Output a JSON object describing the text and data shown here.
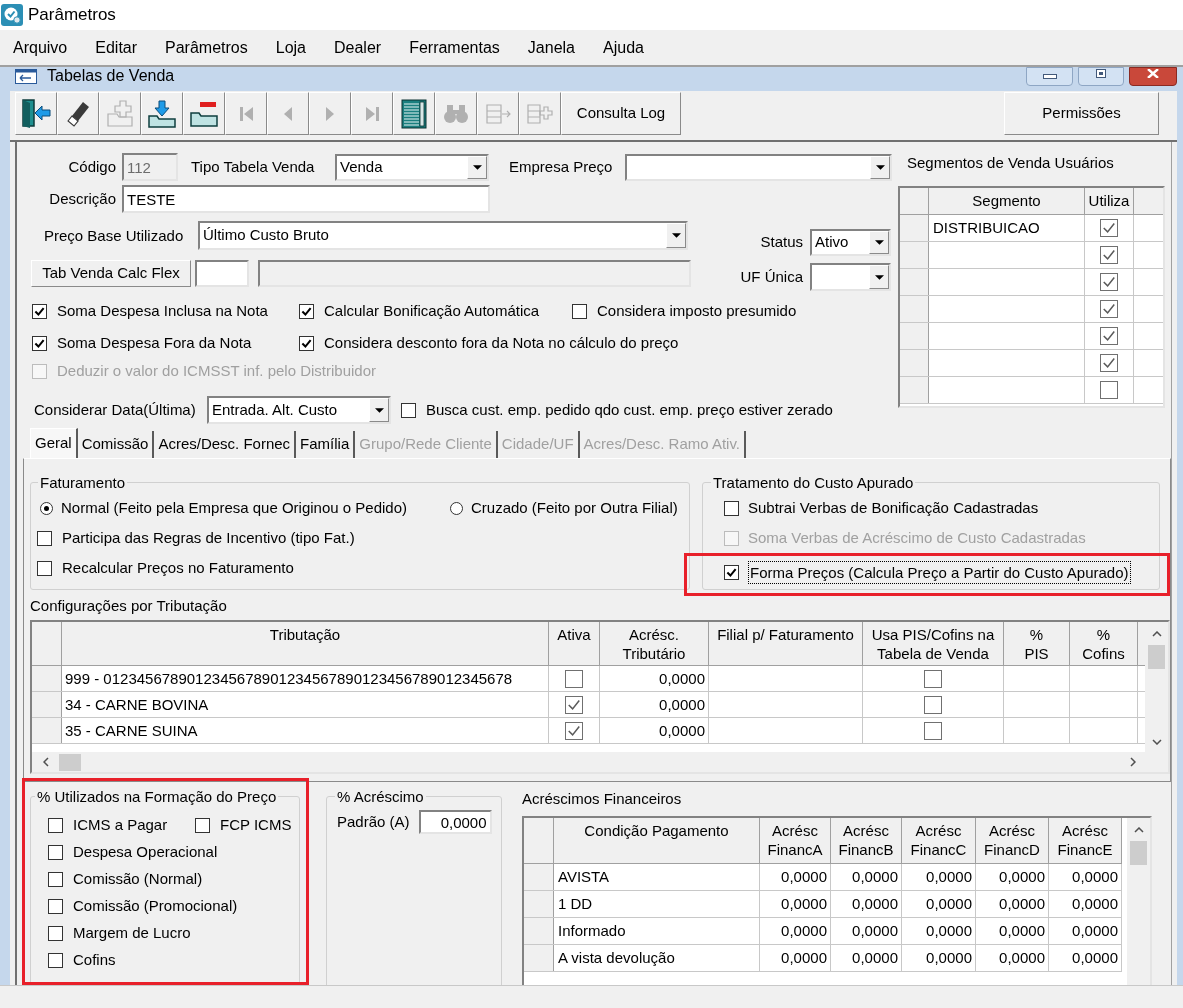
{
  "app": {
    "title": "Parâmetros"
  },
  "menu": [
    "Arquivo",
    "Editar",
    "Parâmetros",
    "Loja",
    "Dealer",
    "Ferramentas",
    "Janela",
    "Ajuda"
  ],
  "window": {
    "title": "Tabelas de Venda"
  },
  "toolbar": {
    "buttons": [
      {
        "kind": "exit",
        "disabled": false
      },
      {
        "kind": "erase",
        "disabled": false
      },
      {
        "kind": "add",
        "disabled": true
      },
      {
        "kind": "save",
        "disabled": false
      },
      {
        "kind": "remove",
        "disabled": false
      },
      {
        "kind": "first",
        "disabled": true
      },
      {
        "kind": "prev",
        "disabled": true
      },
      {
        "kind": "next",
        "disabled": true
      },
      {
        "kind": "last",
        "disabled": true
      },
      {
        "kind": "grid",
        "disabled": false
      },
      {
        "kind": "find",
        "disabled": true
      },
      {
        "kind": "export",
        "disabled": true
      },
      {
        "kind": "import",
        "disabled": true
      }
    ],
    "log_button": "Consulta Log",
    "permissions_button": "Permissões"
  },
  "form": {
    "codigo": {
      "label": "Código",
      "value": "112",
      "disabled": true
    },
    "tipo": {
      "label": "Tipo Tabela Venda",
      "value": "Venda"
    },
    "empresa": {
      "label": "Empresa Preço"
    },
    "descricao": {
      "label": "Descrição",
      "value": "TESTE"
    },
    "preco_base": {
      "label": "Preço Base Utilizado",
      "value": "Último Custo Bruto"
    },
    "calc_flex": {
      "button": "Tab Venda Calc Flex",
      "fields": [
        {
          "disabled": false
        },
        {
          "disabled": true
        }
      ]
    },
    "status": {
      "label": "Status",
      "value": "Ativo"
    },
    "uf": {
      "label": "UF Única"
    },
    "option_rows": [
      [
        {
          "label": "Soma Despesa Inclusa na Nota",
          "checked": true,
          "disabled": false
        },
        {
          "label": "Calcular Bonificação Automática",
          "checked": true,
          "disabled": false
        },
        {
          "label": "Considera imposto presumido",
          "checked": false,
          "disabled": false
        }
      ],
      [
        {
          "label": "Soma Despesa Fora da Nota",
          "checked": true,
          "disabled": false
        },
        {
          "label": "Considera desconto fora da Nota no cálculo do preço",
          "checked": true,
          "disabled": false
        }
      ],
      [
        {
          "label": "Deduzir o valor do ICMSST inf. pelo Distribuidor",
          "checked": false,
          "disabled": true
        }
      ]
    ],
    "data": {
      "label": "Considerar Data(Última)",
      "value": "Entrada. Alt. Custo"
    },
    "busca": {
      "label": "Busca cust. emp. pedido qdo cust. emp. preço estiver zerado",
      "checked": false
    }
  },
  "segments": {
    "title": "Segmentos de Venda Usuários",
    "columns": [
      "Segmento",
      "Utiliza"
    ],
    "rows": [
      {
        "segment": "DISTRIBUICAO",
        "checked": true
      },
      {
        "checked": true
      },
      {
        "checked": true
      },
      {
        "checked": true
      },
      {
        "checked": true
      },
      {
        "checked": true
      },
      {
        "checked": false
      }
    ]
  },
  "tabs": [
    {
      "label": "Geral",
      "selected": true,
      "disabled": false
    },
    {
      "label": "Comissão",
      "selected": false,
      "disabled": false
    },
    {
      "label": "Acres/Desc. Fornec",
      "selected": false,
      "disabled": false
    },
    {
      "label": "Família",
      "selected": false,
      "disabled": false
    },
    {
      "label": "Grupo/Rede Cliente",
      "selected": false,
      "disabled": true
    },
    {
      "label": "Cidade/UF",
      "selected": false,
      "disabled": true
    },
    {
      "label": "Acres/Desc. Ramo Ativ.",
      "selected": false,
      "disabled": true
    }
  ],
  "faturamento": {
    "title": "Faturamento",
    "radios": [
      {
        "label": "Normal (Feito pela Empresa que Originou o Pedido)",
        "selected": true
      },
      {
        "label": "Cruzado (Feito por Outra Filial)",
        "selected": false
      }
    ],
    "checks": [
      {
        "label": "Participa das Regras de Incentivo (tipo Fat.)",
        "checked": false
      },
      {
        "label": "Recalcular Preços no Faturamento",
        "checked": false
      }
    ]
  },
  "custo": {
    "title": "Tratamento do Custo Apurado",
    "checks": [
      {
        "label": "Subtrai Verbas de Bonificação Cadastradas",
        "checked": false,
        "disabled": false,
        "focused": false,
        "highlighted": false
      },
      {
        "label": "Soma Verbas de Acréscimo de Custo Cadastradas",
        "checked": false,
        "disabled": true,
        "focused": false,
        "highlighted": false
      },
      {
        "label": "Forma Preços (Calcula Preço a Partir do Custo Apurado)",
        "checked": true,
        "disabled": false,
        "focused": true,
        "highlighted": true
      }
    ]
  },
  "tributacao": {
    "title": "Configurações por Tributação",
    "columns": [
      "Tributação",
      "Ativa",
      "Acrésc. Tributário",
      "Filial p/ Faturamento",
      "Usa PIS/Cofins na Tabela de Venda",
      "% PIS",
      "% Cofins"
    ],
    "rows": [
      {
        "tributacao": "999 - 0123456789012345678901234567890123456789012345678",
        "ativa": false,
        "acrescimo": "0,0000",
        "usa_pis": false
      },
      {
        "tributacao": "34 - CARNE BOVINA",
        "ativa": true,
        "acrescimo": "0,0000",
        "usa_pis": false
      },
      {
        "tributacao": "35 - CARNE SUINA",
        "ativa": true,
        "acrescimo": "0,0000",
        "usa_pis": false
      }
    ]
  },
  "percentuais": {
    "title": "% Utilizados na Formação do Preço",
    "highlighted": true,
    "rows": [
      [
        {
          "label": "ICMS a Pagar",
          "checked": false
        },
        {
          "label": "FCP ICMS",
          "checked": false
        }
      ],
      [
        {
          "label": "Despesa Operacional",
          "checked": false
        }
      ],
      [
        {
          "label": "Comissão (Normal)",
          "checked": false
        }
      ],
      [
        {
          "label": "Comissão (Promocional)",
          "checked": false
        }
      ],
      [
        {
          "label": "Margem de Lucro",
          "checked": false
        }
      ],
      [
        {
          "label": "Cofins",
          "checked": false
        }
      ]
    ]
  },
  "acrescimo": {
    "title": "% Acréscimo",
    "label": "Padrão (A)",
    "value": "0,0000"
  },
  "financeiros": {
    "title": "Acréscimos Financeiros",
    "columns": [
      "Condição Pagamento",
      "Acrésc FinancA",
      "Acrésc FinancB",
      "Acrésc FinancC",
      "Acrésc FinancD",
      "Acrésc FinancE"
    ],
    "rows": [
      {
        "condicao": "AVISTA",
        "values": [
          "0,0000",
          "0,0000",
          "0,0000",
          "0,0000",
          "0,0000"
        ]
      },
      {
        "condicao": "1 DD",
        "values": [
          "0,0000",
          "0,0000",
          "0,0000",
          "0,0000",
          "0,0000"
        ]
      },
      {
        "condicao": "Informado",
        "values": [
          "0,0000",
          "0,0000",
          "0,0000",
          "0,0000",
          "0,0000"
        ]
      },
      {
        "condicao": "A vista devolução",
        "values": [
          "0,0000",
          "0,0000",
          "0,0000",
          "0,0000",
          "0,0000"
        ]
      }
    ]
  }
}
